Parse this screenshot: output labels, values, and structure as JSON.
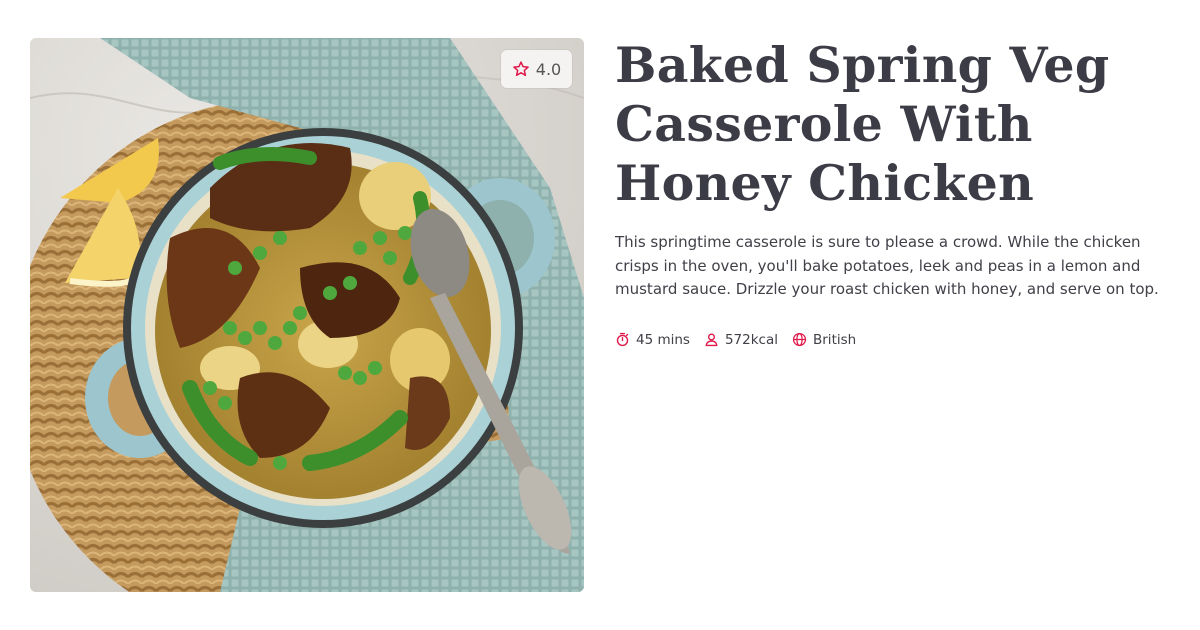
{
  "recipe": {
    "title": "Baked Spring Veg Casserole With Honey Chicken",
    "description": "This springtime casserole is sure to please a crowd. While the chicken crisps in the oven, you'll bake potatoes, leek and peas in a lemon and mustard sauce. Drizzle your roast chicken with honey, and serve on top.",
    "rating": "4.0",
    "meta": {
      "time": "45 mins",
      "calories": "572kcal",
      "cuisine": "British"
    }
  },
  "icons": {
    "rating": "star-outline-icon",
    "time": "stopwatch-icon",
    "calories": "person-icon",
    "cuisine": "globe-icon"
  },
  "colors": {
    "accent": "#e0194a",
    "title": "#3c3c46",
    "text": "#404048"
  }
}
